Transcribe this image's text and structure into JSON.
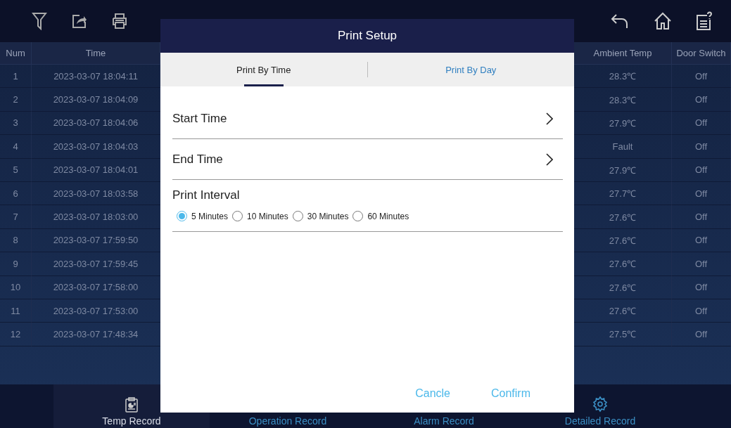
{
  "table": {
    "columns": [
      "Num",
      "Time",
      "Ambient Temp",
      "Door Switch"
    ],
    "rows": [
      [
        "1",
        "2023-03-07 18:04:11",
        "28.3℃",
        "Off"
      ],
      [
        "2",
        "2023-03-07 18:04:09",
        "28.3℃",
        "Off"
      ],
      [
        "3",
        "2023-03-07 18:04:06",
        "27.9℃",
        "Off"
      ],
      [
        "4",
        "2023-03-07 18:04:03",
        "Fault",
        "Off"
      ],
      [
        "5",
        "2023-03-07 18:04:01",
        "27.9℃",
        "Off"
      ],
      [
        "6",
        "2023-03-07 18:03:58",
        "27.7℃",
        "Off"
      ],
      [
        "7",
        "2023-03-07 18:03:00",
        "27.6℃",
        "Off"
      ],
      [
        "8",
        "2023-03-07 17:59:50",
        "27.6℃",
        "Off"
      ],
      [
        "9",
        "2023-03-07 17:59:45",
        "27.6℃",
        "Off"
      ],
      [
        "10",
        "2023-03-07 17:58:00",
        "27.6℃",
        "Off"
      ],
      [
        "11",
        "2023-03-07 17:53:00",
        "27.6℃",
        "Off"
      ],
      [
        "12",
        "2023-03-07 17:48:34",
        "27.5℃",
        "Off"
      ]
    ]
  },
  "bottom_nav": [
    {
      "label": "Temp Record",
      "selected": true
    },
    {
      "label": "Operation Record",
      "selected": false
    },
    {
      "label": "Alarm Record",
      "selected": false
    },
    {
      "label": "Detailed Record",
      "selected": false
    }
  ],
  "dialog": {
    "title": "Print Setup",
    "tabs": [
      {
        "label": "Print By Time",
        "selected": true
      },
      {
        "label": "Print By Day",
        "selected": false
      }
    ],
    "rows": [
      {
        "label": "Start Time"
      },
      {
        "label": "End Time"
      }
    ],
    "interval": {
      "label": "Print Interval",
      "options": [
        {
          "label": "5 Minutes",
          "selected": true
        },
        {
          "label": "10 Minutes",
          "selected": false
        },
        {
          "label": "30 Minutes",
          "selected": false
        },
        {
          "label": "60 Minutes",
          "selected": false
        }
      ]
    },
    "buttons": [
      "Cancle",
      "Confirm"
    ]
  }
}
